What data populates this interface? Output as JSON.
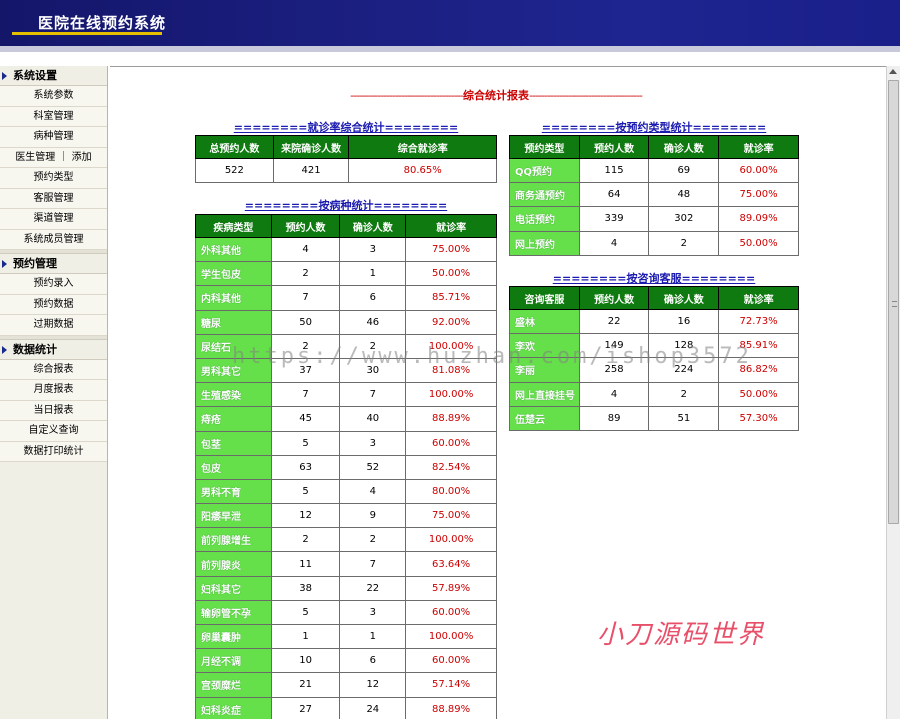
{
  "header": {
    "title": "医院在线预约系统"
  },
  "sidebar": {
    "groups": [
      {
        "title": "系统设置",
        "items": [
          "系统参数",
          "科室管理",
          "病种管理",
          "医生管理 ｜ 添加",
          "预约类型",
          "客服管理",
          "渠道管理",
          "系统成员管理"
        ]
      },
      {
        "title": "预约管理",
        "items": [
          "预约录入",
          "预约数据",
          "过期数据"
        ]
      },
      {
        "title": "数据统计",
        "items": [
          "综合报表",
          "月度报表",
          "当日报表",
          "自定义查询",
          "数据打印统计"
        ]
      }
    ]
  },
  "report": {
    "title": "综合统计报表",
    "dashes": "--------------------------------------"
  },
  "overall": {
    "title": "========就诊率综合统计========",
    "headers": [
      "总预约人数",
      "来院确诊人数",
      "综合就诊率"
    ],
    "row": [
      "522",
      "421",
      "80.65%"
    ]
  },
  "disease": {
    "title": "========按病种统计========",
    "headers": [
      "疾病类型",
      "预约人数",
      "确诊人数",
      "就诊率"
    ],
    "rows": [
      [
        "外科其他",
        "4",
        "3",
        "75.00%"
      ],
      [
        "学生包皮",
        "2",
        "1",
        "50.00%"
      ],
      [
        "内科其他",
        "7",
        "6",
        "85.71%"
      ],
      [
        "糖尿",
        "50",
        "46",
        "92.00%"
      ],
      [
        "尿结石",
        "2",
        "2",
        "100.00%"
      ],
      [
        "男科其它",
        "37",
        "30",
        "81.08%"
      ],
      [
        "生殖感染",
        "7",
        "7",
        "100.00%"
      ],
      [
        "痔疮",
        "45",
        "40",
        "88.89%"
      ],
      [
        "包茎",
        "5",
        "3",
        "60.00%"
      ],
      [
        "包皮",
        "63",
        "52",
        "82.54%"
      ],
      [
        "男科不育",
        "5",
        "4",
        "80.00%"
      ],
      [
        "阳痿早泄",
        "12",
        "9",
        "75.00%"
      ],
      [
        "前列腺增生",
        "2",
        "2",
        "100.00%"
      ],
      [
        "前列腺炎",
        "11",
        "7",
        "63.64%"
      ],
      [
        "妇科其它",
        "38",
        "22",
        "57.89%"
      ],
      [
        "输卵管不孕",
        "5",
        "3",
        "60.00%"
      ],
      [
        "卵巢囊肿",
        "1",
        "1",
        "100.00%"
      ],
      [
        "月经不调",
        "10",
        "6",
        "60.00%"
      ],
      [
        "宫颈糜烂",
        "21",
        "12",
        "57.14%"
      ],
      [
        "妇科炎症",
        "27",
        "24",
        "88.89%"
      ]
    ]
  },
  "type": {
    "title": "========按预约类型统计========",
    "headers": [
      "预约类型",
      "预约人数",
      "确诊人数",
      "就诊率"
    ],
    "rows": [
      [
        "QQ预约",
        "115",
        "69",
        "60.00%"
      ],
      [
        "商务通预约",
        "64",
        "48",
        "75.00%"
      ],
      [
        "电话预约",
        "339",
        "302",
        "89.09%"
      ],
      [
        "网上预约",
        "4",
        "2",
        "50.00%"
      ]
    ]
  },
  "service": {
    "title": "========按咨询客服========",
    "headers": [
      "咨询客服",
      "预约人数",
      "确诊人数",
      "就诊率"
    ],
    "rows": [
      [
        "盛林",
        "22",
        "16",
        "72.73%"
      ],
      [
        "李欢",
        "149",
        "128",
        "85.91%"
      ],
      [
        "李丽",
        "258",
        "224",
        "86.82%"
      ],
      [
        "网上直接挂号",
        "4",
        "2",
        "50.00%"
      ],
      [
        "伍楚云",
        "89",
        "51",
        "57.30%"
      ]
    ]
  },
  "watermark": "https://www.huzhan.com/ishop3572",
  "signature": "小刀源码世界"
}
